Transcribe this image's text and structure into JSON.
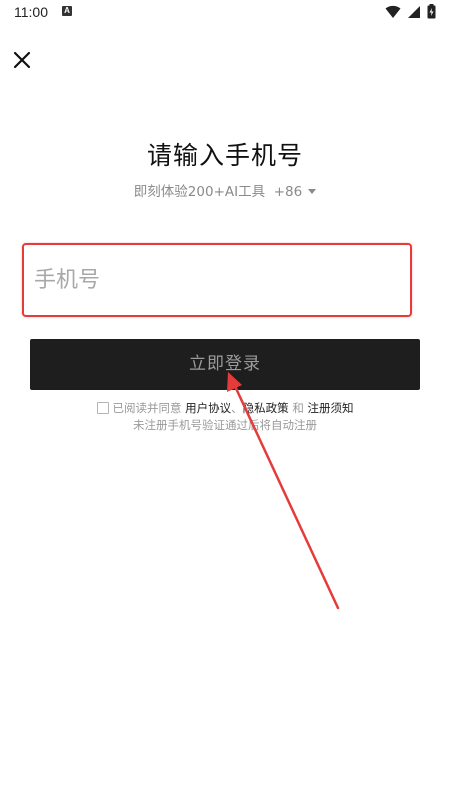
{
  "status_bar": {
    "time": "11:00",
    "app_icon_letter": "A"
  },
  "login": {
    "title": "请输入手机号",
    "subtitle_prefix": "即刻体验200+AI工具",
    "country_code": "+86",
    "phone_placeholder": "手机号",
    "phone_value": "",
    "login_button": "立即登录"
  },
  "agreement": {
    "text_prefix": "已阅读并同意",
    "user_agreement": "用户协议",
    "separator": "、",
    "privacy_policy": "隐私政策",
    "conjunction": "和",
    "registration_notice": "注册须知",
    "note": "未注册手机号验证通过后将自动注册"
  },
  "colors": {
    "highlight_red": "#e53b3b",
    "button_bg": "#1e1e1f",
    "button_text": "#9b9b9b"
  }
}
